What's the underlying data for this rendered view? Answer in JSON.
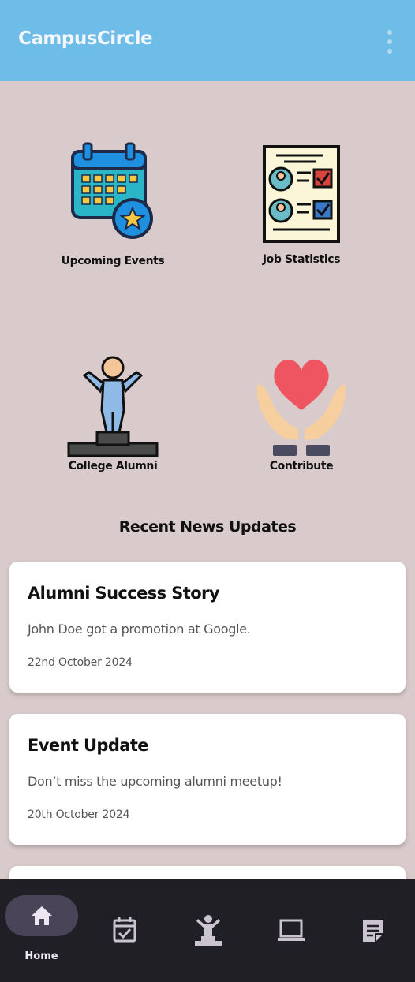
{
  "app": {
    "title": "CampusCircle",
    "accent_color": "#6dbde8",
    "background_color": "#d9cbcb",
    "menu_icon": "more-vert-icon"
  },
  "tiles": [
    {
      "label": "Upcoming Events",
      "icon": "calendar-star-icon"
    },
    {
      "label": "Job Statistics",
      "icon": "resume-checklist-icon"
    },
    {
      "label": "College Alumni",
      "icon": "podium-person-icon"
    },
    {
      "label": "Contribute",
      "icon": "heart-hands-icon"
    }
  ],
  "news": {
    "section_title": "Recent News  Updates",
    "items": [
      {
        "title": "Alumni Success Story",
        "body": "John Doe got a promotion at Google.",
        "date": "22nd October 2024"
      },
      {
        "title": "Event Update",
        "body": "Don’t miss the upcoming alumni meetup!",
        "date": "20th October 2024"
      }
    ]
  },
  "bottom_nav": {
    "items": [
      {
        "label": "Home",
        "icon": "home-icon",
        "active": true
      },
      {
        "label": "",
        "icon": "calendar-check-icon",
        "active": false
      },
      {
        "label": "",
        "icon": "podium-icon",
        "active": false
      },
      {
        "label": "",
        "icon": "laptop-icon",
        "active": false
      },
      {
        "label": "",
        "icon": "note-icon",
        "active": false
      }
    ]
  }
}
